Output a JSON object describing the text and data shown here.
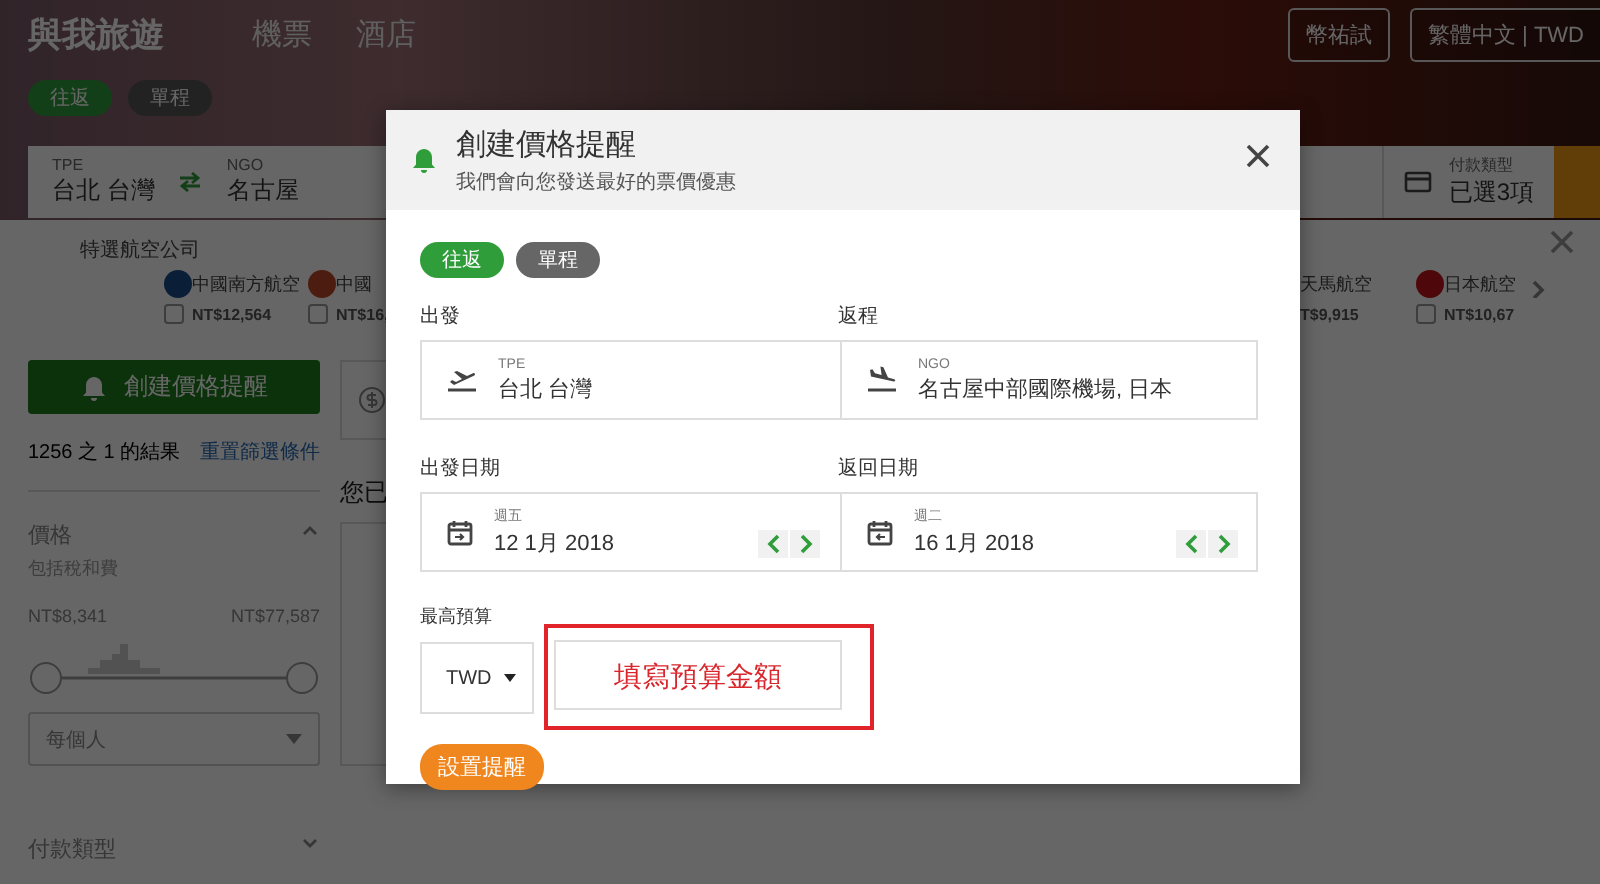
{
  "header": {
    "logo": "與我旅遊",
    "nav": [
      {
        "label": "機票"
      },
      {
        "label": "酒店"
      }
    ],
    "currency_button": "幣祐試",
    "language_button": "繁體中文 | TWD"
  },
  "trip_type": [
    {
      "label": "往返",
      "selected": true
    },
    {
      "label": "單程",
      "selected": false
    }
  ],
  "search_bar": {
    "origin": {
      "code": "TPE",
      "city": "台北 台灣"
    },
    "destination": {
      "code": "NGO",
      "city": "名古屋"
    },
    "payment": {
      "label": "付款類型",
      "value": "已選3項"
    }
  },
  "airlines": {
    "title": "特選航空公司",
    "items": [
      {
        "name": "中國南方航空",
        "price": "NT$12,564",
        "checked": false
      },
      {
        "name": "中國",
        "price": "NT$16,",
        "checked": false
      },
      {
        "name": "天馬航空",
        "price": "T$9,915"
      },
      {
        "name": "日本航空",
        "price": "NT$10,67",
        "checked": false
      }
    ]
  },
  "sidebar": {
    "alert_button": "創建價格提醒",
    "results": "1256 之 1 的結果",
    "reset_link": "重置篩選條件",
    "price": {
      "title": "價格",
      "subtitle": "包括稅和費",
      "min": "NT$8,341",
      "max": "NT$77,587",
      "per": "每個人"
    },
    "payment_title": "付款類型"
  },
  "main": {
    "heading": "您已"
  },
  "modal": {
    "title": "創建價格提醒",
    "subtitle": "我們會向您發送最好的票價優惠",
    "trip_type": [
      {
        "label": "往返",
        "selected": true
      },
      {
        "label": "單程",
        "selected": false
      }
    ],
    "depart_label": "出發",
    "return_label": "返程",
    "origin": {
      "code": "TPE",
      "city": "台北 台灣"
    },
    "destination": {
      "code": "NGO",
      "city": "名古屋中部國際機場, 日本"
    },
    "depart_date_label": "出發日期",
    "return_date_label": "返回日期",
    "depart_date": {
      "weekday": "週五",
      "date": "12 1月 2018"
    },
    "return_date": {
      "weekday": "週二",
      "date": "16 1月 2018"
    },
    "budget_label": "最高預算",
    "currency": "TWD",
    "budget_placeholder": "填寫預算金額",
    "submit": "設置提醒"
  }
}
